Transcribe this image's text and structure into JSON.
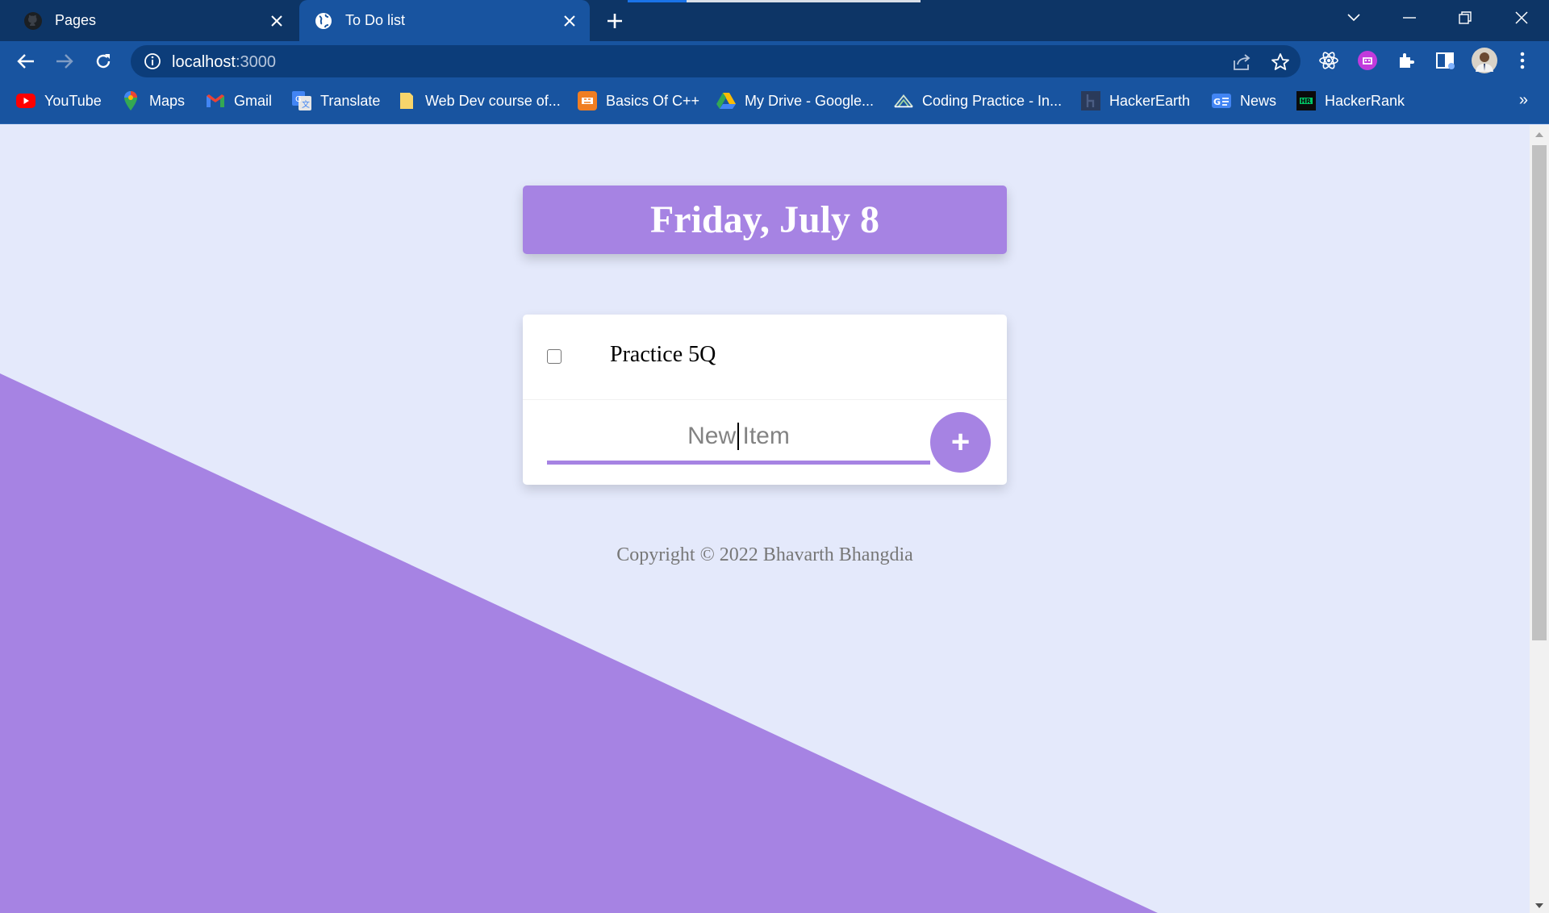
{
  "tabs": [
    {
      "title": "Pages",
      "favicon": "github-icon",
      "active": false
    },
    {
      "title": "To Do list",
      "favicon": "globe-icon",
      "active": true
    }
  ],
  "address_bar": {
    "host": "localhost",
    "port": ":3000"
  },
  "bookmarks": [
    {
      "label": "YouTube",
      "icon": "youtube-icon"
    },
    {
      "label": "Maps",
      "icon": "maps-icon"
    },
    {
      "label": "Gmail",
      "icon": "gmail-icon"
    },
    {
      "label": "Translate",
      "icon": "translate-icon"
    },
    {
      "label": "Web Dev course of...",
      "icon": "folder-note-icon"
    },
    {
      "label": "Basics Of C++",
      "icon": "cpp-icon"
    },
    {
      "label": "My Drive - Google...",
      "icon": "drive-icon"
    },
    {
      "label": "Coding Practice - In...",
      "icon": "coding-icon"
    },
    {
      "label": "HackerEarth",
      "icon": "hackerearth-icon"
    },
    {
      "label": "News",
      "icon": "news-icon"
    },
    {
      "label": "HackerRank",
      "icon": "hackerrank-icon"
    }
  ],
  "bookmarks_overflow": "»",
  "page": {
    "heading": "Friday, July 8",
    "items": [
      {
        "text": "Practice 5Q",
        "checked": false
      }
    ],
    "new_item": {
      "placeholder": "New Item",
      "add_label": "+"
    },
    "footer": "Copyright © 2022 Bhavarth Bhangdia"
  },
  "colors": {
    "accent": "#a683e3",
    "background": "#e4e9fb",
    "chrome": "#1854a0"
  }
}
